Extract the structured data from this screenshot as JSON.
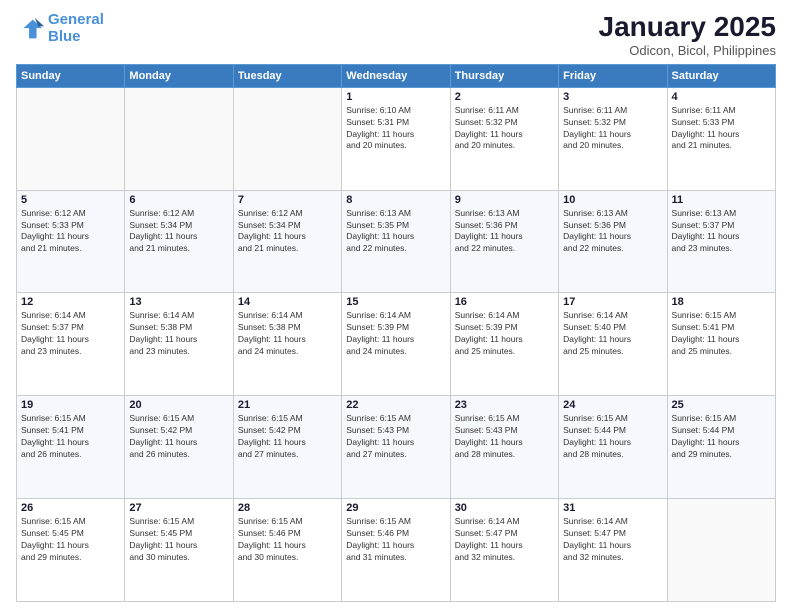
{
  "logo": {
    "line1": "General",
    "line2": "Blue"
  },
  "header": {
    "title": "January 2025",
    "subtitle": "Odicon, Bicol, Philippines"
  },
  "weekdays": [
    "Sunday",
    "Monday",
    "Tuesday",
    "Wednesday",
    "Thursday",
    "Friday",
    "Saturday"
  ],
  "weeks": [
    [
      {
        "day": "",
        "info": ""
      },
      {
        "day": "",
        "info": ""
      },
      {
        "day": "",
        "info": ""
      },
      {
        "day": "1",
        "info": "Sunrise: 6:10 AM\nSunset: 5:31 PM\nDaylight: 11 hours\nand 20 minutes."
      },
      {
        "day": "2",
        "info": "Sunrise: 6:11 AM\nSunset: 5:32 PM\nDaylight: 11 hours\nand 20 minutes."
      },
      {
        "day": "3",
        "info": "Sunrise: 6:11 AM\nSunset: 5:32 PM\nDaylight: 11 hours\nand 20 minutes."
      },
      {
        "day": "4",
        "info": "Sunrise: 6:11 AM\nSunset: 5:33 PM\nDaylight: 11 hours\nand 21 minutes."
      }
    ],
    [
      {
        "day": "5",
        "info": "Sunrise: 6:12 AM\nSunset: 5:33 PM\nDaylight: 11 hours\nand 21 minutes."
      },
      {
        "day": "6",
        "info": "Sunrise: 6:12 AM\nSunset: 5:34 PM\nDaylight: 11 hours\nand 21 minutes."
      },
      {
        "day": "7",
        "info": "Sunrise: 6:12 AM\nSunset: 5:34 PM\nDaylight: 11 hours\nand 21 minutes."
      },
      {
        "day": "8",
        "info": "Sunrise: 6:13 AM\nSunset: 5:35 PM\nDaylight: 11 hours\nand 22 minutes."
      },
      {
        "day": "9",
        "info": "Sunrise: 6:13 AM\nSunset: 5:36 PM\nDaylight: 11 hours\nand 22 minutes."
      },
      {
        "day": "10",
        "info": "Sunrise: 6:13 AM\nSunset: 5:36 PM\nDaylight: 11 hours\nand 22 minutes."
      },
      {
        "day": "11",
        "info": "Sunrise: 6:13 AM\nSunset: 5:37 PM\nDaylight: 11 hours\nand 23 minutes."
      }
    ],
    [
      {
        "day": "12",
        "info": "Sunrise: 6:14 AM\nSunset: 5:37 PM\nDaylight: 11 hours\nand 23 minutes."
      },
      {
        "day": "13",
        "info": "Sunrise: 6:14 AM\nSunset: 5:38 PM\nDaylight: 11 hours\nand 23 minutes."
      },
      {
        "day": "14",
        "info": "Sunrise: 6:14 AM\nSunset: 5:38 PM\nDaylight: 11 hours\nand 24 minutes."
      },
      {
        "day": "15",
        "info": "Sunrise: 6:14 AM\nSunset: 5:39 PM\nDaylight: 11 hours\nand 24 minutes."
      },
      {
        "day": "16",
        "info": "Sunrise: 6:14 AM\nSunset: 5:39 PM\nDaylight: 11 hours\nand 25 minutes."
      },
      {
        "day": "17",
        "info": "Sunrise: 6:14 AM\nSunset: 5:40 PM\nDaylight: 11 hours\nand 25 minutes."
      },
      {
        "day": "18",
        "info": "Sunrise: 6:15 AM\nSunset: 5:41 PM\nDaylight: 11 hours\nand 25 minutes."
      }
    ],
    [
      {
        "day": "19",
        "info": "Sunrise: 6:15 AM\nSunset: 5:41 PM\nDaylight: 11 hours\nand 26 minutes."
      },
      {
        "day": "20",
        "info": "Sunrise: 6:15 AM\nSunset: 5:42 PM\nDaylight: 11 hours\nand 26 minutes."
      },
      {
        "day": "21",
        "info": "Sunrise: 6:15 AM\nSunset: 5:42 PM\nDaylight: 11 hours\nand 27 minutes."
      },
      {
        "day": "22",
        "info": "Sunrise: 6:15 AM\nSunset: 5:43 PM\nDaylight: 11 hours\nand 27 minutes."
      },
      {
        "day": "23",
        "info": "Sunrise: 6:15 AM\nSunset: 5:43 PM\nDaylight: 11 hours\nand 28 minutes."
      },
      {
        "day": "24",
        "info": "Sunrise: 6:15 AM\nSunset: 5:44 PM\nDaylight: 11 hours\nand 28 minutes."
      },
      {
        "day": "25",
        "info": "Sunrise: 6:15 AM\nSunset: 5:44 PM\nDaylight: 11 hours\nand 29 minutes."
      }
    ],
    [
      {
        "day": "26",
        "info": "Sunrise: 6:15 AM\nSunset: 5:45 PM\nDaylight: 11 hours\nand 29 minutes."
      },
      {
        "day": "27",
        "info": "Sunrise: 6:15 AM\nSunset: 5:45 PM\nDaylight: 11 hours\nand 30 minutes."
      },
      {
        "day": "28",
        "info": "Sunrise: 6:15 AM\nSunset: 5:46 PM\nDaylight: 11 hours\nand 30 minutes."
      },
      {
        "day": "29",
        "info": "Sunrise: 6:15 AM\nSunset: 5:46 PM\nDaylight: 11 hours\nand 31 minutes."
      },
      {
        "day": "30",
        "info": "Sunrise: 6:14 AM\nSunset: 5:47 PM\nDaylight: 11 hours\nand 32 minutes."
      },
      {
        "day": "31",
        "info": "Sunrise: 6:14 AM\nSunset: 5:47 PM\nDaylight: 11 hours\nand 32 minutes."
      },
      {
        "day": "",
        "info": ""
      }
    ]
  ]
}
